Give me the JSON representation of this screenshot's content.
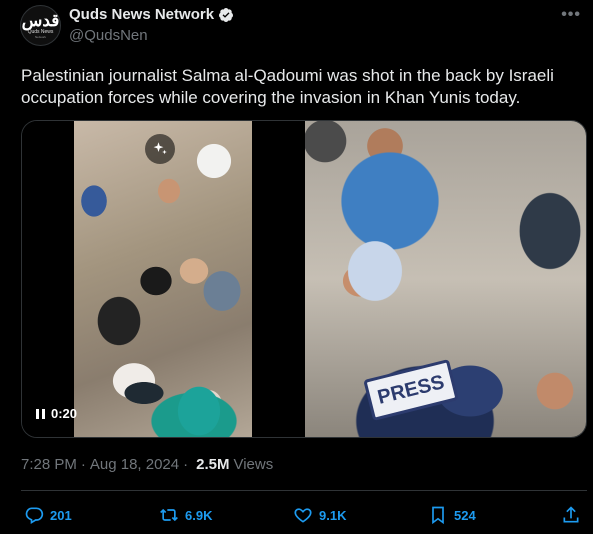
{
  "author": {
    "display_name": "Quds News Network",
    "handle": "@QudsNen",
    "avatar_logo": "قدس",
    "avatar_sub": "Quds News",
    "avatar_sub2": "Network"
  },
  "more_icon": "•••",
  "text": "Palestinian journalist Salma al-Qadoumi was shot in the back by Israeli occupation forces while covering the invasion in Khan Yunis today.",
  "media": {
    "video_time": "0:20",
    "press_label": "PRESS"
  },
  "meta": {
    "time": "7:28 PM",
    "date": "Aug 18, 2024",
    "separator": "·",
    "views_count": "2.5M",
    "views_label": "Views"
  },
  "actions": {
    "replies": "201",
    "reposts": "6.9K",
    "likes": "9.1K",
    "bookmarks": "524"
  },
  "colors": {
    "background": "#000000",
    "accent": "#1d9bf0",
    "muted": "#71767b",
    "text": "#e7e9ea"
  }
}
